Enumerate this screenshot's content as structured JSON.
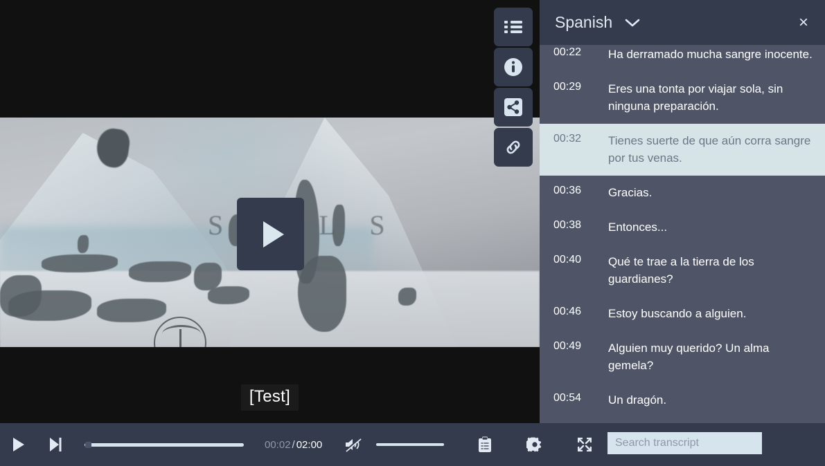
{
  "player": {
    "caption_text": "[Test]",
    "video_title_glyph": "S   TEL S",
    "play_button_label": "play-large",
    "side_actions": [
      {
        "name": "transcript-list",
        "label": "Transcript"
      },
      {
        "name": "info",
        "label": "Info"
      },
      {
        "name": "share",
        "label": "Share"
      },
      {
        "name": "link",
        "label": "Copy link"
      }
    ]
  },
  "controls": {
    "play_label": "Play",
    "next_label": "Next",
    "current_time": "00:02",
    "separator": "/",
    "duration": "02:00",
    "mute_label": "Unmute",
    "volume_label": "Volume",
    "clipboard_label": "Notes",
    "settings_label": "Settings",
    "fullscreen_label": "Fullscreen",
    "seek_position_percent": 2,
    "volume_percent": 100
  },
  "search": {
    "placeholder": "Search transcript",
    "value": ""
  },
  "transcript": {
    "language": "Spanish",
    "close_label": "×",
    "active_index": 2,
    "cues": [
      {
        "time": "00:22",
        "text": "Ha derramado mucha sangre inocente."
      },
      {
        "time": "00:29",
        "text": "Eres una tonta por viajar sola, sin ninguna preparación."
      },
      {
        "time": "00:32",
        "text": "Tienes suerte de que aún corra sangre por tus venas."
      },
      {
        "time": "00:36",
        "text": "Gracias."
      },
      {
        "time": "00:38",
        "text": "Entonces..."
      },
      {
        "time": "00:40",
        "text": "Qué te trae a la tierra de los guardianes?"
      },
      {
        "time": "00:46",
        "text": "Estoy buscando a alguien."
      },
      {
        "time": "00:49",
        "text": "Alguien muy querido? Un alma gemela?"
      },
      {
        "time": "00:54",
        "text": "Un dragón."
      }
    ]
  },
  "colors": {
    "panel_dark": "#333b4c",
    "transcript_bg": "#4f5566",
    "active_cue_bg": "#d6e4e7",
    "accent_light": "#d6e4ee",
    "letterbox": "#111111"
  }
}
